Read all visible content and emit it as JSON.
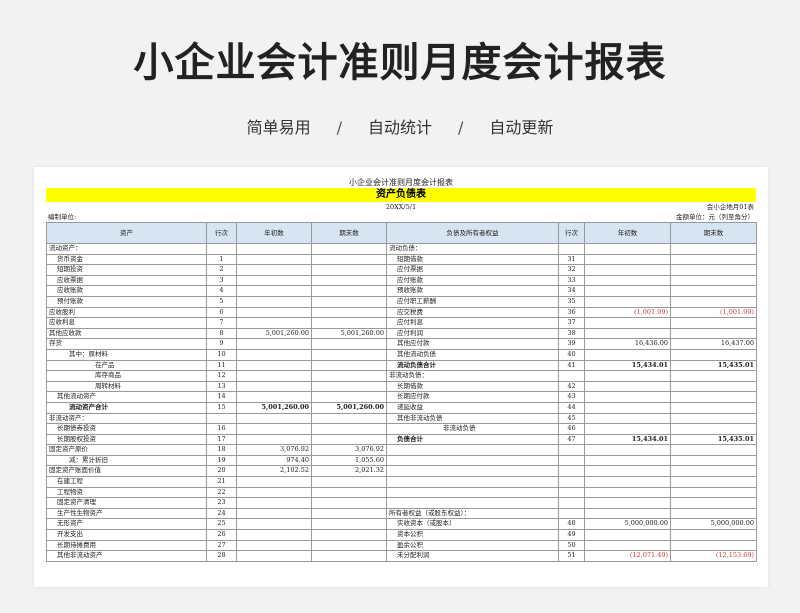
{
  "header": {
    "title": "小企业会计准则月度会计报表",
    "tags": [
      "简单易用",
      "自动统计",
      "自动更新"
    ],
    "separator": "/"
  },
  "sheet": {
    "doc_title": "小企业会计准则月度会计报表",
    "banner": "资产负债表",
    "date": "20XX/5/1",
    "form_no": "会小企地月01表",
    "unit_label": "编制单位:",
    "currency_label": "金额单位：元（列至角分）",
    "columns": [
      "资产",
      "行次",
      "年初数",
      "期末数",
      "负债及所有者权益",
      "行次",
      "年初数",
      "期末数"
    ],
    "rows": [
      {
        "a": "流动资产：",
        "al": "",
        "an": "",
        "ae": "",
        "l": "流动负债：",
        "ll": "",
        "ln": "",
        "le": ""
      },
      {
        "a": "货币资金",
        "al": "1",
        "an": "",
        "ae": "",
        "l": "短期借款",
        "ll": "31",
        "ln": "",
        "le": ""
      },
      {
        "a": "短期投资",
        "al": "2",
        "an": "",
        "ae": "",
        "l": "应付票据",
        "ll": "32",
        "ln": "",
        "le": ""
      },
      {
        "a": "应收票据",
        "al": "3",
        "an": "",
        "ae": "",
        "l": "应付账款",
        "ll": "33",
        "ln": "",
        "le": ""
      },
      {
        "a": "应收账款",
        "al": "4",
        "an": "",
        "ae": "",
        "l": "预收账款",
        "ll": "34",
        "ln": "",
        "le": ""
      },
      {
        "a": "预付账款",
        "al": "5",
        "an": "",
        "ae": "",
        "l": "应付职工薪酬",
        "ll": "35",
        "ln": "",
        "le": ""
      },
      {
        "a": "应收股利",
        "al": "6",
        "an": "",
        "ae": "",
        "l": "应交税费",
        "ll": "36",
        "ln": "(1,001.99)",
        "le": "(1,001.99)"
      },
      {
        "a": "应收利息",
        "al": "7",
        "an": "",
        "ae": "",
        "l": "应付利息",
        "ll": "37",
        "ln": "",
        "le": ""
      },
      {
        "a": "其他应收款",
        "al": "8",
        "an": "5,001,260.00",
        "ae": "5,001,260.00",
        "l": "应付利润",
        "ll": "38",
        "ln": "",
        "le": ""
      },
      {
        "a": "存货",
        "al": "9",
        "an": "",
        "ae": "",
        "l": "其他应付款",
        "ll": "39",
        "ln": "16,436.00",
        "le": "16,437.00"
      },
      {
        "a": "其中：原材料",
        "al": "10",
        "an": "",
        "ae": "",
        "l": "其他流动负债",
        "ll": "40",
        "ln": "",
        "le": ""
      },
      {
        "a": "在产品",
        "al": "11",
        "an": "",
        "ae": "",
        "l": "流动负债合计",
        "ll": "41",
        "ln": "15,434.01",
        "le": "15,435.01"
      },
      {
        "a": "库存商品",
        "al": "12",
        "an": "",
        "ae": "",
        "l": "非流动负债：",
        "ll": "",
        "ln": "",
        "le": ""
      },
      {
        "a": "周转材料",
        "al": "13",
        "an": "",
        "ae": "",
        "l": "长期借款",
        "ll": "42",
        "ln": "",
        "le": ""
      },
      {
        "a": "其他流动资产",
        "al": "14",
        "an": "",
        "ae": "",
        "l": "长期应付款",
        "ll": "43",
        "ln": "",
        "le": ""
      },
      {
        "a": "流动资产合计",
        "al": "15",
        "an": "5,001,260.00",
        "ae": "5,001,260.00",
        "l": "递延收益",
        "ll": "44",
        "ln": "",
        "le": ""
      },
      {
        "a": "非流动资产：",
        "al": "",
        "an": "",
        "ae": "",
        "l": "其他非流动负债",
        "ll": "45",
        "ln": "",
        "le": ""
      },
      {
        "a": "长期债券投资",
        "al": "16",
        "an": "",
        "ae": "",
        "l": "非流动负债",
        "ll": "46",
        "ln": "",
        "le": ""
      },
      {
        "a": "长期股权投资",
        "al": "17",
        "an": "",
        "ae": "",
        "l": "负债合计",
        "ll": "47",
        "ln": "15,434.01",
        "le": "15,435.01"
      },
      {
        "a": "固定资产原价",
        "al": "18",
        "an": "3,076.92",
        "ae": "3,076.92",
        "l": "",
        "ll": "",
        "ln": "",
        "le": ""
      },
      {
        "a": "减：累计折旧",
        "al": "19",
        "an": "974.40",
        "ae": "1,055.60",
        "l": "",
        "ll": "",
        "ln": "",
        "le": ""
      },
      {
        "a": "固定资产账面价值",
        "al": "20",
        "an": "2,102.52",
        "ae": "2,021.32",
        "l": "",
        "ll": "",
        "ln": "",
        "le": ""
      },
      {
        "a": "在建工程",
        "al": "21",
        "an": "",
        "ae": "",
        "l": "",
        "ll": "",
        "ln": "",
        "le": ""
      },
      {
        "a": "工程物资",
        "al": "22",
        "an": "",
        "ae": "",
        "l": "",
        "ll": "",
        "ln": "",
        "le": ""
      },
      {
        "a": "固定资产清理",
        "al": "23",
        "an": "",
        "ae": "",
        "l": "",
        "ll": "",
        "ln": "",
        "le": ""
      },
      {
        "a": "生产性生物资产",
        "al": "24",
        "an": "",
        "ae": "",
        "l": "所有者权益（或股东权益）：",
        "ll": "",
        "ln": "",
        "le": ""
      },
      {
        "a": "无形资产",
        "al": "25",
        "an": "",
        "ae": "",
        "l": "实收资本（或股本）",
        "ll": "48",
        "ln": "5,000,000.00",
        "le": "5,000,000.00"
      },
      {
        "a": "开发支出",
        "al": "26",
        "an": "",
        "ae": "",
        "l": "资本公积",
        "ll": "49",
        "ln": "",
        "le": ""
      },
      {
        "a": "长期待摊费用",
        "al": "27",
        "an": "",
        "ae": "",
        "l": "盈余公积",
        "ll": "50",
        "ln": "",
        "le": ""
      },
      {
        "a": "其他非流动资产",
        "al": "28",
        "an": "",
        "ae": "",
        "l": "未分配利润",
        "ll": "51",
        "ln": "(12,071.49)",
        "le": "(12,153.69)"
      }
    ]
  }
}
